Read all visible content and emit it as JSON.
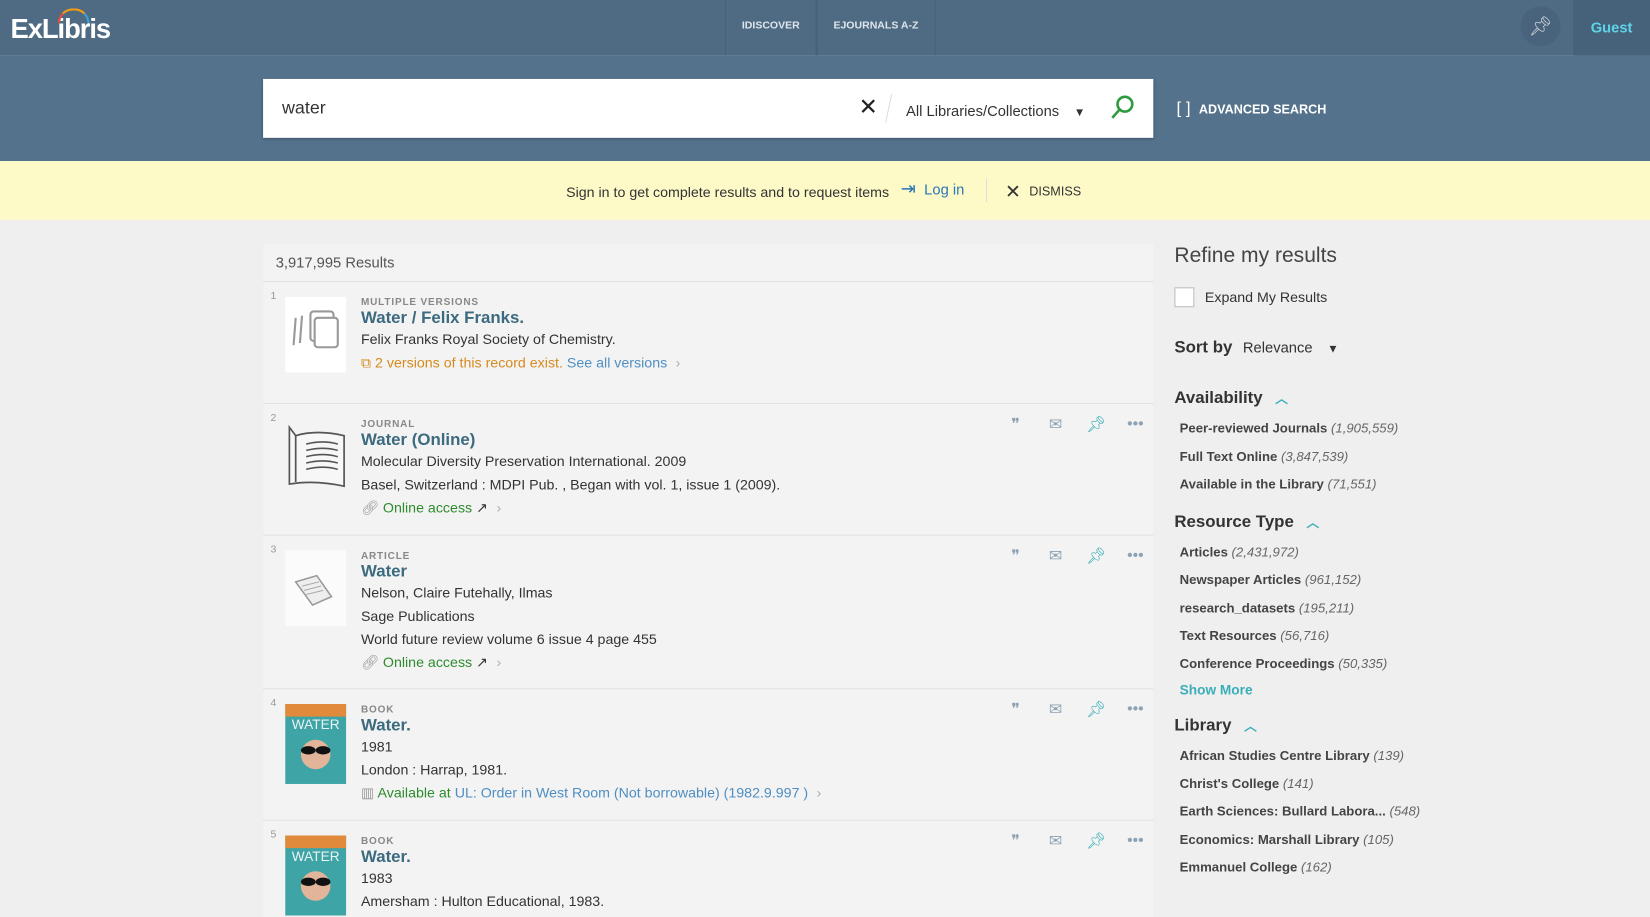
{
  "header": {
    "logo": "ExLibris",
    "nav": [
      "IDISCOVER",
      "EJOURNALS A-Z"
    ],
    "user": "Guest"
  },
  "search": {
    "query": "water",
    "scope": "All Libraries/Collections",
    "advanced": "ADVANCED SEARCH"
  },
  "banner": {
    "message": "Sign in to get complete results and to request items",
    "login": "Log in",
    "dismiss": "DISMISS"
  },
  "results": {
    "count": "3,917,995 Results",
    "items": [
      {
        "num": "1",
        "type": "MULTIPLE VERSIONS",
        "title": "Water / Felix Franks.",
        "lines": [
          "Felix Franks Royal Society of Chemistry."
        ],
        "versions": "2 versions of this record exist.",
        "versions_link": "See all versions",
        "thumb": "versions"
      },
      {
        "num": "2",
        "type": "JOURNAL",
        "title": "Water (Online)",
        "lines": [
          "Molecular Diversity Preservation International. 2009",
          "Basel, Switzerland : MDPI Pub. , Began with vol. 1, issue 1 (2009)."
        ],
        "access": "Online access",
        "thumb": "journal"
      },
      {
        "num": "3",
        "type": "ARTICLE",
        "title": "Water",
        "lines": [
          "Nelson, Claire Futehally, Ilmas",
          "Sage Publications",
          "World future review volume 6 issue 4 page 455"
        ],
        "access": "Online access",
        "thumb": "article"
      },
      {
        "num": "4",
        "type": "BOOK",
        "title": "Water.",
        "lines": [
          "1981",
          "London : Harrap, 1981."
        ],
        "available": "Available at",
        "location": "UL: Order in West Room (Not borrowable) (1982.9.997 )",
        "thumb": "cover"
      },
      {
        "num": "5",
        "type": "BOOK",
        "title": "Water.",
        "lines": [
          "1983",
          "Amersham : Hulton Educational, 1983."
        ],
        "thumb": "cover"
      }
    ]
  },
  "refine": {
    "title": "Refine my results",
    "expand": "Expand My Results",
    "sort_label": "Sort by",
    "sort_value": "Relevance",
    "facets": [
      {
        "name": "Availability",
        "items": [
          [
            "Peer-reviewed Journals",
            "(1,905,559)"
          ],
          [
            "Full Text Online",
            "(3,847,539)"
          ],
          [
            "Available in the Library",
            "(71,551)"
          ]
        ]
      },
      {
        "name": "Resource Type",
        "items": [
          [
            "Articles",
            "(2,431,972)"
          ],
          [
            "Newspaper Articles",
            "(961,152)"
          ],
          [
            "research_datasets",
            "(195,211)"
          ],
          [
            "Text Resources",
            "(56,716)"
          ],
          [
            "Conference Proceedings",
            "(50,335)"
          ]
        ],
        "more": "Show More"
      },
      {
        "name": "Library",
        "items": [
          [
            "African Studies Centre Library",
            "(139)"
          ],
          [
            "Christ's College",
            "(141)"
          ],
          [
            "Earth Sciences: Bullard Labora...",
            "(548)"
          ],
          [
            "Economics: Marshall Library",
            "(105)"
          ],
          [
            "Emmanuel College",
            "(162)"
          ]
        ]
      }
    ]
  },
  "colors": {
    "topbar": "#4f6b84",
    "search_band": "#54728c",
    "banner": "#fdfac8",
    "accent": "#3aaeb8",
    "title": "#3c6a7f",
    "green": "#2e8b2e"
  }
}
